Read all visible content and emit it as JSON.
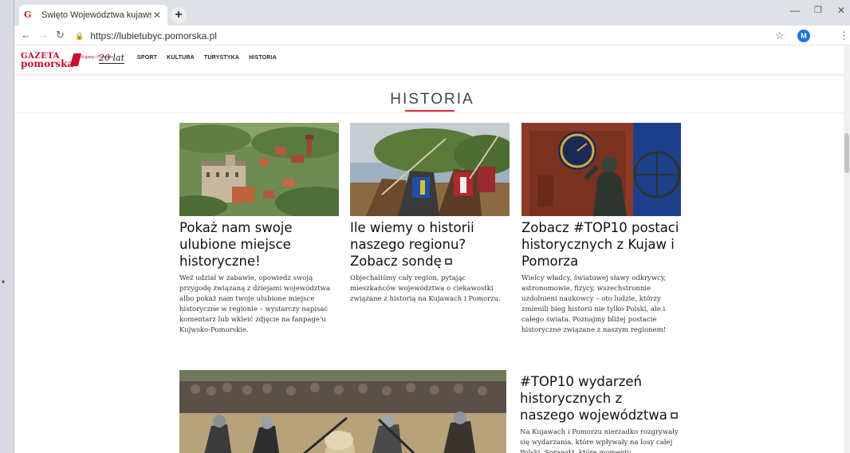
{
  "browser": {
    "tab_title": "Święto Województwa kujawsko-p",
    "tab_favicon": "G",
    "new_tab": "+",
    "url": "https://lubietubyc.pomorska.pl",
    "profile_initial": "M"
  },
  "site": {
    "logo_top": "GAZETA",
    "logo_bottom": "pomorska",
    "logo_small": "Kujawy i Pomorze",
    "logo_years": "20 lat",
    "nav": [
      "SPORT",
      "KULTURA",
      "TURYSTYKA",
      "HISTORIA"
    ]
  },
  "section": {
    "title": "HISTORIA"
  },
  "cards": [
    {
      "title": "Pokaż nam swoje ulubione miejsce historyczne!",
      "text": "Weź udział w zabawie, opowiedz swoją przygodę związaną z dziejami województwa albo pokaż nam twoje ulubione miejsce historyczne w regionie – wystarczy napisać komentarz lub wkleić zdjęcie na fanpage'u Kujwsko-Pomorskie."
    },
    {
      "title": "Ile wiemy o historii naszego regionu? Zobacz sondę",
      "text": "Objechaliśmy cały region, pytając mieszkańców województwa o ciekawostki związane z historią na Kujawach i Pomorzu."
    },
    {
      "title": "Zobacz #TOP10 postaci historycznych z Kujaw i Pomorza",
      "text": "Wielcy władcy, światowej sławy odkrywcy, astronomowie, fizycy, wszechstronnie uzdolnieni naukowcy – oto ludzie, którzy zmienili bieg historii nie tylko Polski, ale i całego świata. Poznajmy bliżej postacie historyczne związane z naszym regionem!"
    },
    {
      "title": "#TOP10 wydarzeń historycznych z naszego województwa",
      "text": "Na Kujawach i Pomorzu nierzadko rozgrywały się wydarzania, które wpływały na losy całej Polski. Sprawdź, które momenty"
    }
  ],
  "colors": {
    "accent": "#d42b3a",
    "brand_red": "#c8102e"
  }
}
